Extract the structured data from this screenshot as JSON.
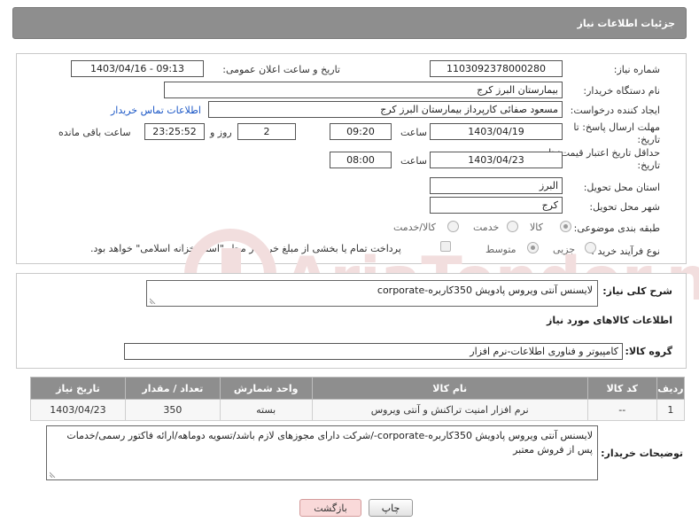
{
  "header": {
    "title": "جزئیات اطلاعات نیاز"
  },
  "form": {
    "need_number": {
      "label": "شماره نیاز:",
      "value": "1103092378000280"
    },
    "announce_datetime": {
      "label": "تاریخ و ساعت اعلان عمومی:",
      "value": "1403/04/16 - 09:13"
    },
    "buyer_org": {
      "label": "نام دستگاه خریدار:",
      "value": "بیمارستان البرز کرج"
    },
    "requester": {
      "label": "ایجاد کننده درخواست:",
      "value": "مسعود صفائی کارپرداز بیمارستان البرز کرج",
      "contact_link": "اطلاعات تماس خریدار"
    },
    "reply_deadline": {
      "label_line1": "مهلت ارسال پاسخ: تا",
      "label_line2": "تاریخ:",
      "date": "1403/04/19",
      "time_label": "ساعت",
      "time": "09:20",
      "days": "2",
      "days_label": "روز و",
      "remaining": "23:25:52",
      "remaining_label": "ساعت باقی مانده"
    },
    "price_validity": {
      "label_line1": "حداقل تاریخ اعتبار قیمت: تا",
      "label_line2": "تاریخ:",
      "date": "1403/04/23",
      "time_label": "ساعت",
      "time": "08:00"
    },
    "delivery_province": {
      "label": "استان محل تحویل:",
      "value": "البرز"
    },
    "delivery_city": {
      "label": "شهر محل تحویل:",
      "value": "کرج"
    },
    "subject_class": {
      "label": "طبقه بندی موضوعی:",
      "options": [
        "کالا",
        "خدمت",
        "کالا/خدمت"
      ],
      "selected": "کالا"
    },
    "purchase_type": {
      "label": "نوع فرآیند خرید :",
      "options": [
        "جزیی",
        "متوسط"
      ],
      "selected": "متوسط",
      "payment_note": "پرداخت تمام یا بخشی از مبلغ خرید،از محل \"اسناد خزانه اسلامی\" خواهد بود."
    }
  },
  "need_description": {
    "label": "شرح کلی نیاز:",
    "value": "لایسنس آنتی ویروس پادویش 350کاربره-corporate"
  },
  "goods_section": {
    "title": "اطلاعات کالاهای مورد نیاز",
    "group_label": "گروه کالا:",
    "group_value": "کامپیوتر و فناوری اطلاعات-نرم افزار"
  },
  "table": {
    "headers": [
      "ردیف",
      "کد کالا",
      "نام کالا",
      "واحد شمارش",
      "تعداد / مقدار",
      "تاریخ نیاز"
    ],
    "rows": [
      {
        "row": "1",
        "code": "--",
        "name": "نرم افزار امنیت تراکنش و آنتی ویروس",
        "unit": "بسته",
        "qty": "350",
        "date": "1403/04/23"
      }
    ]
  },
  "buyer_notes": {
    "label": "توضیحات خریدار:",
    "value": "لایسنس آنتی ویروس پادویش 350کاربره-corporate-/شرکت دارای مجوزهای لازم باشد/تسویه دوماهه/ارائه فاکتور رسمی/خدمات پس از فروش معتبر"
  },
  "buttons": {
    "print": "چاپ",
    "back": "بازگشت"
  },
  "watermark": {
    "text": "AriaTender.neT"
  },
  "colors": {
    "header_bg": "#8e8e8e",
    "link": "#1b57c6",
    "back_button": "#f9d9d9",
    "watermark": "#f2dede"
  }
}
